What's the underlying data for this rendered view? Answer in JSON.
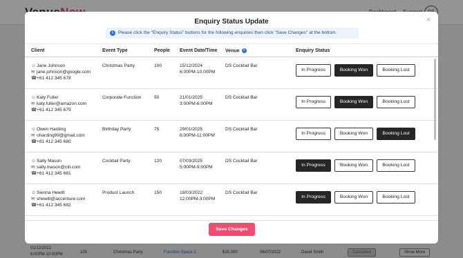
{
  "app": {
    "logo_main": "Venue",
    "logo_accent": "Now"
  },
  "nav": {
    "item1": "Dashboard",
    "item2": "Support",
    "avatar": "DS"
  },
  "bg_row": {
    "date": "01/12/2022",
    "time": "6:00PM-10:00PM",
    "people": "100",
    "event_type": "Christmas Party",
    "venue": "Function Space 1",
    "value": "$15,000",
    "date2": "06/07/2022",
    "contact": "David Smith",
    "status": "Cancelled",
    "show_more": "Show More"
  },
  "modal": {
    "title": "Enquiry Status Update",
    "info": "Please click the \"Enquiry Status\" buttons for the following enquiries then click \"Save Changes\" at the bottom.",
    "close": "×",
    "headers": {
      "client": "Client",
      "event_type": "Event Type",
      "people": "People",
      "date_time": "Event Date/Time",
      "venue": "Venue",
      "status": "Enquiry Status"
    },
    "buttons": {
      "in_progress": "In Progress",
      "won": "Booking Won",
      "lost": "Booking Lost"
    },
    "save": "Save Changes"
  },
  "enquiries": [
    {
      "name": "Jane Johnson",
      "email": "jane.johnson@google.com",
      "phone": "+61 412 345 678",
      "event_type": "Christmas Party",
      "people": "100",
      "date": "15/12/2024",
      "time": "6:00PM-10:00PM",
      "venue": "DS Cocktail Bar",
      "status": "won"
    },
    {
      "name": "Katy Fuller",
      "email": "katy.fuller@amazon.com",
      "phone": "+61 412 345 679",
      "event_type": "Corporate Function",
      "people": "50",
      "date": "21/01/2025",
      "time": "3:00PM-6:00PM",
      "venue": "DS Cocktail Bar",
      "status": "won"
    },
    {
      "name": "Owen Harding",
      "email": "oharding99@gmail.com",
      "phone": "+61 412 345 680",
      "event_type": "Birthday Party",
      "people": "75",
      "date": "29/01/2025",
      "time": "6:00PM-11:00PM",
      "venue": "DS Cocktail Bar",
      "status": "lost"
    },
    {
      "name": "Sally Mason",
      "email": "sally.mason@citi.com",
      "phone": "+61 412 345 681",
      "event_type": "Cocktail Party",
      "people": "120",
      "date": "07/03/2025",
      "time": "5:00PM-9:00PM",
      "venue": "DS Cocktail Bar",
      "status": "in_progress"
    },
    {
      "name": "Sienna Hewitt",
      "email": "shewitt@accenture.com",
      "phone": "+61 412 345 682",
      "event_type": "Product Launch",
      "people": "150",
      "date": "18/03/2022",
      "time": "12:00PM-3:00PM",
      "venue": "DS Cocktail Bar",
      "status": "in_progress"
    }
  ],
  "colors": {
    "accent": "#ee4d72",
    "active_button": "#262626",
    "info_blue": "#2f6fd1"
  },
  "icons": {
    "person": "person-icon",
    "mail": "mail-icon",
    "phone": "phone-icon",
    "info": "info-icon",
    "close": "close-icon"
  }
}
